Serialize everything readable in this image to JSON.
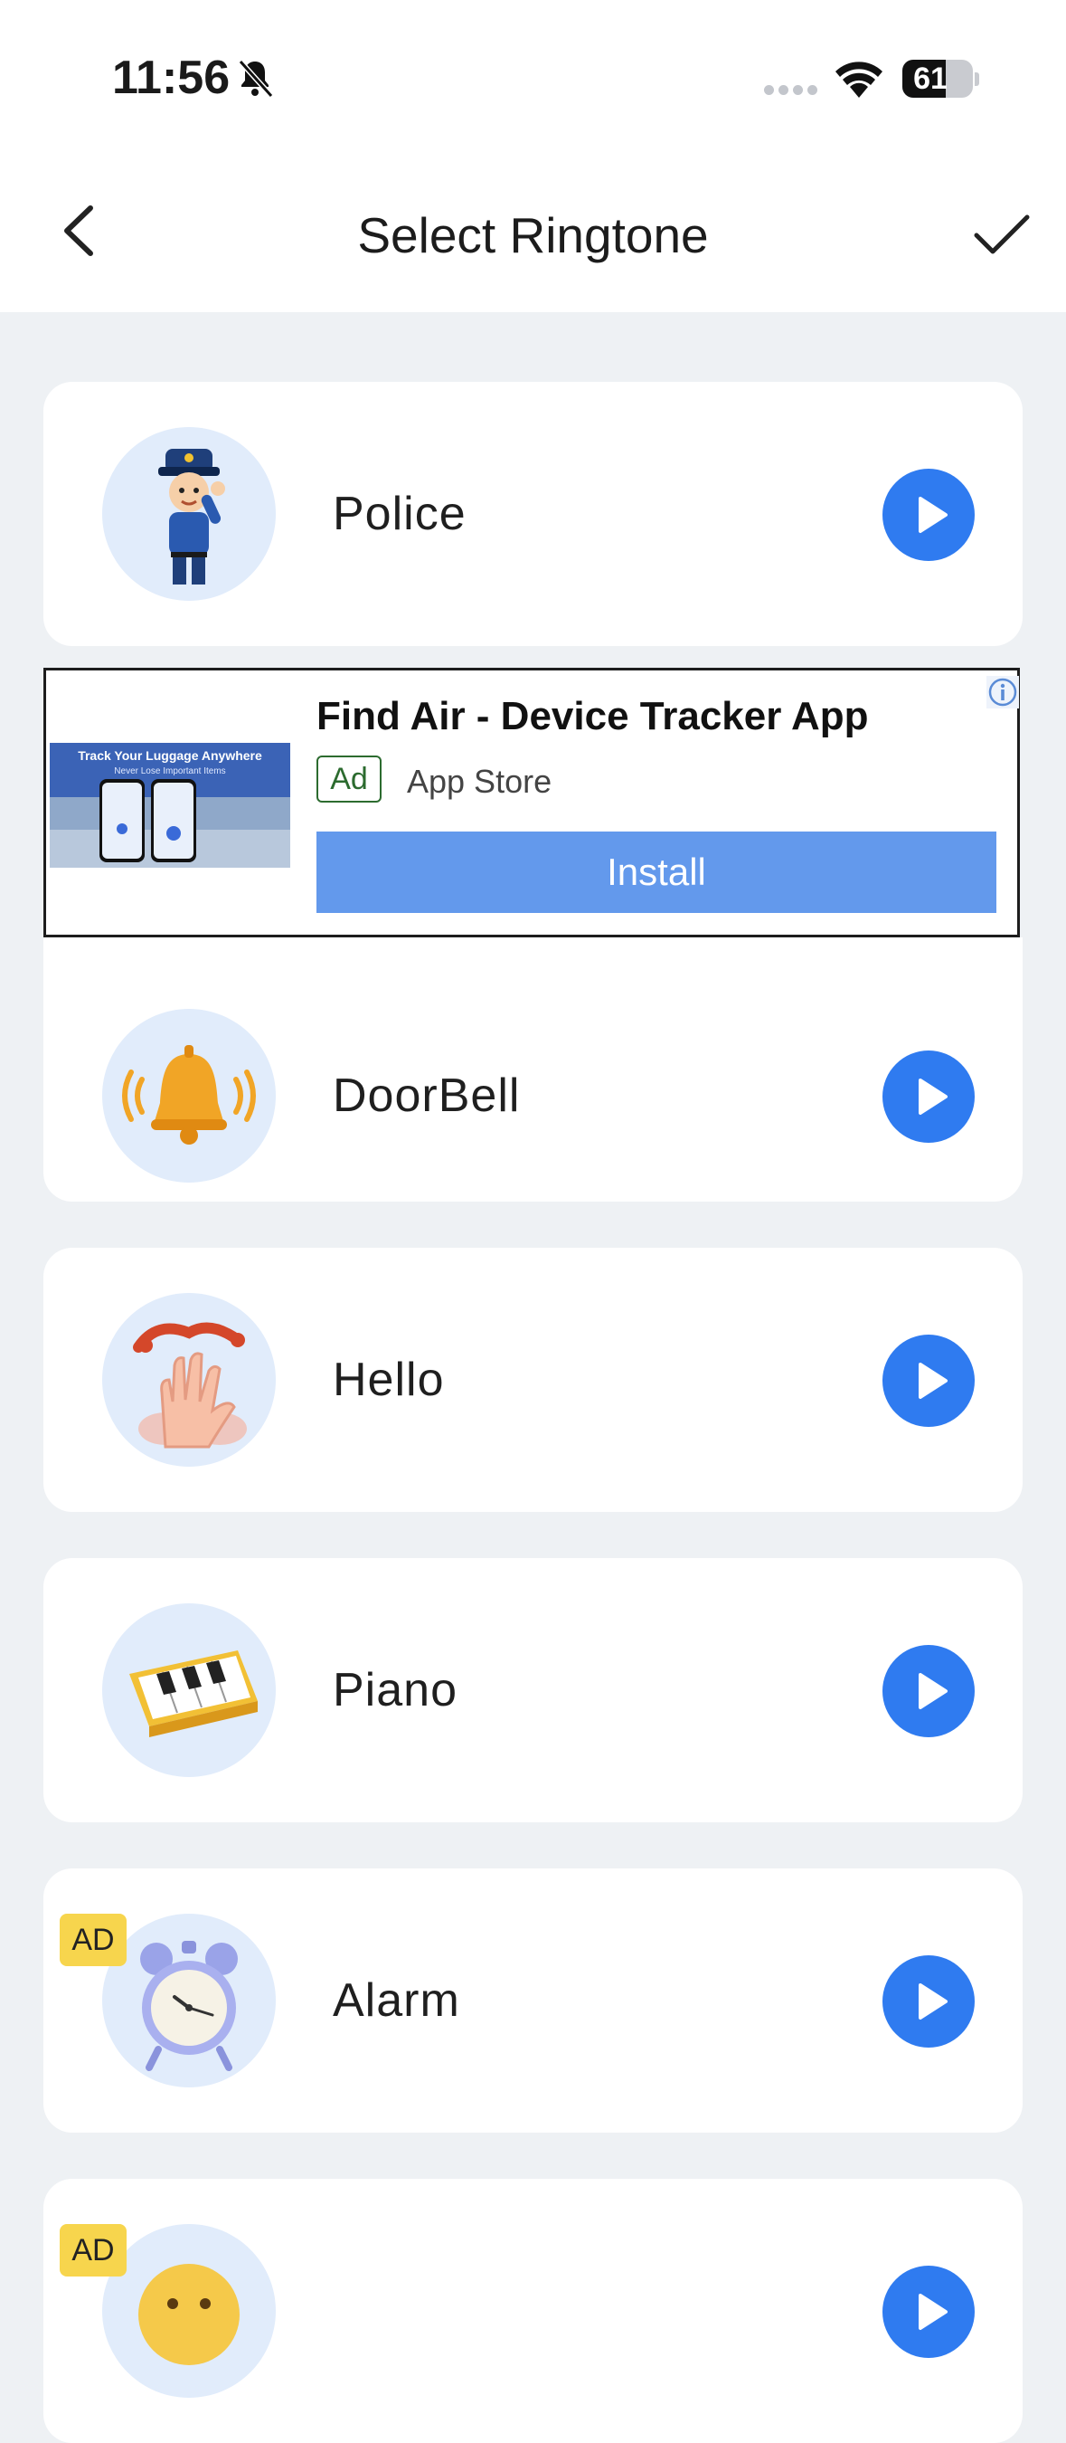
{
  "status_bar": {
    "time": "11:56",
    "battery": "61",
    "battery_level_pct": 61
  },
  "header": {
    "title": "Select Ringtone"
  },
  "icons": {
    "back": "chevron-left-icon",
    "confirm": "checkmark-icon",
    "play": "play-icon",
    "ad_info": "info-icon"
  },
  "colors": {
    "accent": "#2f7bf0",
    "install": "#6399ec",
    "ad_badge": "#f7d54d",
    "avatar_bg": "#e1ecfb"
  },
  "ad": {
    "title": "Find Air - Device Tracker App",
    "tag": "Ad",
    "source": "App Store",
    "cta": "Install",
    "image_caption": "Track Your Luggage Anywhere",
    "image_subcaption": "Never Lose Important Items"
  },
  "ringtones": [
    {
      "label": "Police",
      "icon": "police-officer-icon",
      "ad_badge": ""
    },
    {
      "label": "DoorBell",
      "icon": "doorbell-icon",
      "ad_badge": ""
    },
    {
      "label": "Hello",
      "icon": "waving-hand-icon",
      "ad_badge": ""
    },
    {
      "label": "Piano",
      "icon": "piano-keys-icon",
      "ad_badge": ""
    },
    {
      "label": "Alarm",
      "icon": "alarm-clock-icon",
      "ad_badge": "AD"
    },
    {
      "label": "",
      "icon": "smiley-face-icon",
      "ad_badge": "AD"
    }
  ]
}
